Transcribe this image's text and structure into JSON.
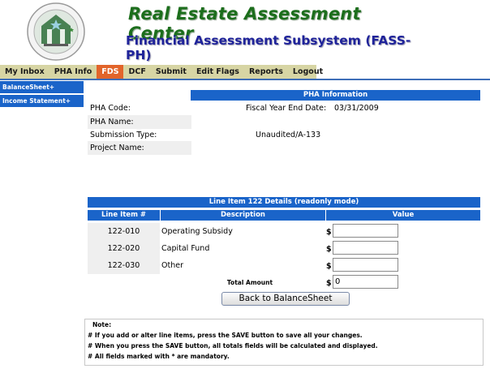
{
  "header": {
    "title": "Real Estate Assessment Center",
    "subtitle": "Financial Assessment Subsystem (FASS-PH)",
    "logo_icon": "hud-seal-icon"
  },
  "nav": {
    "items": [
      {
        "label": "My Inbox"
      },
      {
        "label": "PHA Info"
      },
      {
        "label": "FDS",
        "active": true
      },
      {
        "label": "DCF"
      },
      {
        "label": "Submit"
      },
      {
        "label": "Edit Flags"
      },
      {
        "label": "Reports"
      },
      {
        "label": "Logout"
      }
    ]
  },
  "sidebar": {
    "items": [
      {
        "label": "BalanceSheet+"
      },
      {
        "label": "Income Statement+"
      }
    ]
  },
  "pha_info": {
    "heading": "PHA Information",
    "code_label": "PHA Code:",
    "fiscal_year_label": "Fiscal Year End Date:",
    "fiscal_year_value": "03/31/2009",
    "name_label": "PHA Name:",
    "submission_type_label": "Submission Type:",
    "submission_type_value": "Unaudited/A-133",
    "project_name_label": "Project Name:"
  },
  "line_items": {
    "heading": "Line Item 122 Details (readonly mode)",
    "columns": [
      "Line Item #",
      "Description",
      "Value"
    ],
    "currency_symbol": "$",
    "rows": [
      {
        "item": "122-010",
        "description": "Operating Subsidy",
        "value": ""
      },
      {
        "item": "122-020",
        "description": "Capital Fund",
        "value": ""
      },
      {
        "item": "122-030",
        "description": "Other",
        "value": ""
      }
    ],
    "total_label": "Total Amount",
    "total_value": "0"
  },
  "actions": {
    "back_label": "Back to BalanceSheet"
  },
  "notes": {
    "title": "Note:",
    "lines": [
      "# If you add or alter line items, press the SAVE button to save all your changes.",
      "# When you press the SAVE button, all totals fields will be calculated and displayed.",
      "# All fields marked with * are mandatory."
    ]
  },
  "colors": {
    "header_blue": "#1a64c9",
    "nav_bg": "#d7d5a4",
    "nav_active": "#e2642a",
    "title_green": "#1c6e1c",
    "subtitle_navy": "#1f239a"
  }
}
